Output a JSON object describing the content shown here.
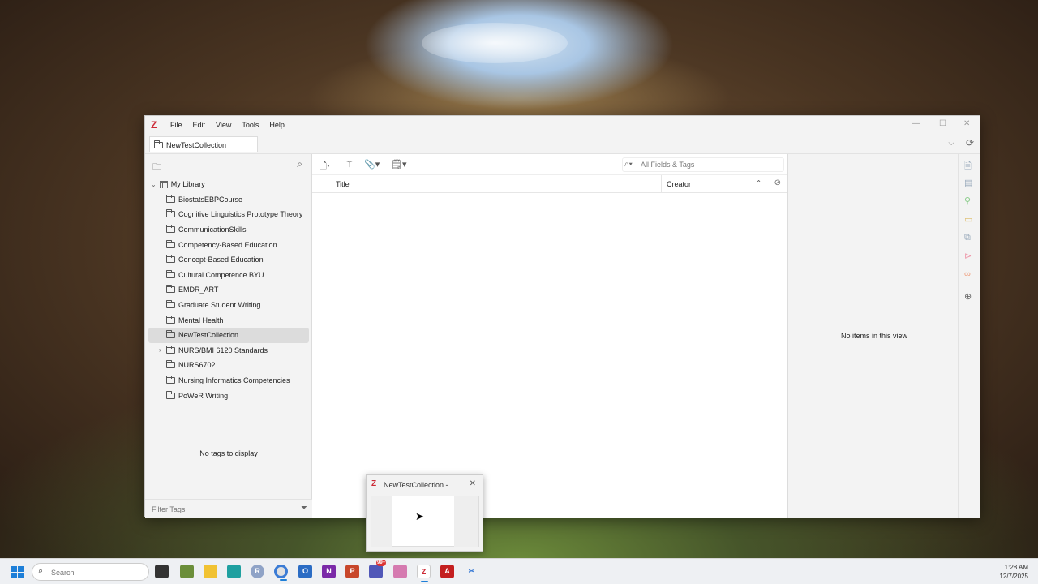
{
  "window": {
    "menu": [
      "File",
      "Edit",
      "View",
      "Tools",
      "Help"
    ],
    "tab_label": "NewTestCollection"
  },
  "library": {
    "root": "My Library",
    "collections": [
      {
        "label": "BiostatsEBPCourse"
      },
      {
        "label": "Cognitive Linguistics Prototype Theory"
      },
      {
        "label": "CommunicationSkills"
      },
      {
        "label": "Competency-Based Education"
      },
      {
        "label": "Concept-Based Education"
      },
      {
        "label": "Cultural Competence BYU"
      },
      {
        "label": "EMDR_ART"
      },
      {
        "label": "Graduate Student Writing"
      },
      {
        "label": "Mental Health"
      },
      {
        "label": "NewTestCollection",
        "selected": true
      },
      {
        "label": "NURS/BMI 6120 Standards",
        "expandable": true
      },
      {
        "label": "NURS6702"
      },
      {
        "label": "Nursing Informatics Competencies"
      },
      {
        "label": "PoWeR Writing"
      }
    ]
  },
  "tags": {
    "empty_message": "No tags to display",
    "filter_placeholder": "Filter Tags"
  },
  "items": {
    "search_placeholder": "All Fields & Tags",
    "columns": {
      "title": "Title",
      "creator": "Creator"
    }
  },
  "item_pane": {
    "empty_message": "No items in this view"
  },
  "thumbnail": {
    "title": "NewTestCollection -..."
  },
  "taskbar": {
    "search_placeholder": "Search",
    "time": "1:28 AM",
    "date": "12/7/2025",
    "badge": "99+"
  },
  "colors": {
    "zotero_red": "#cc2936",
    "windows_blue": "#1e7fd8"
  }
}
